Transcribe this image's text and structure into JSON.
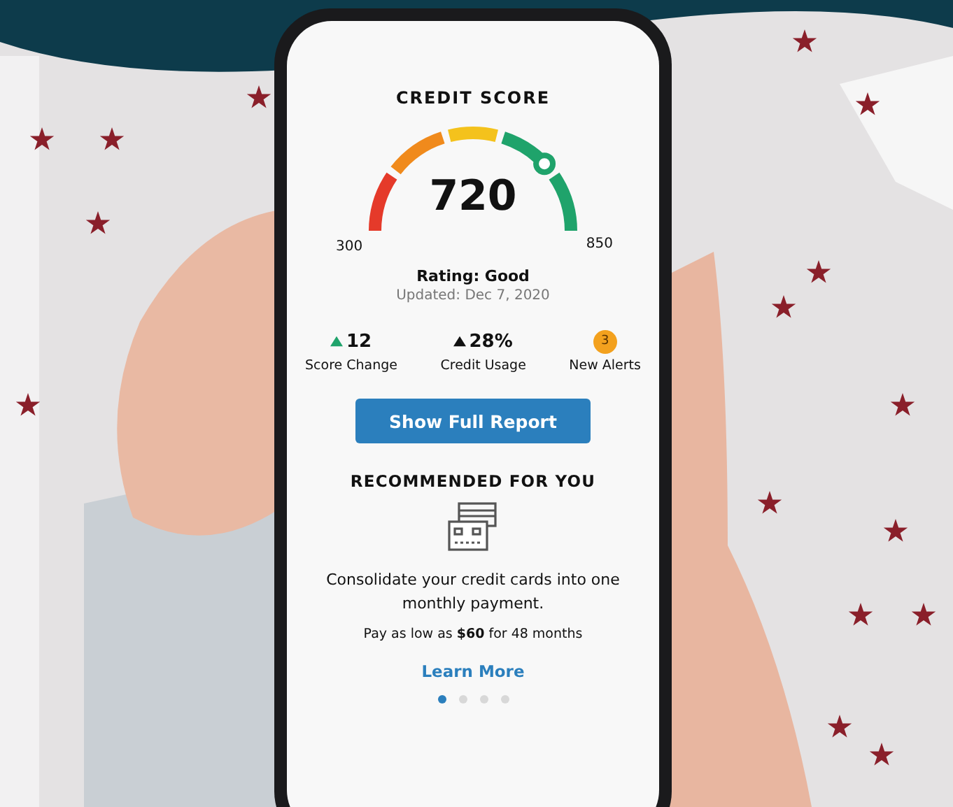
{
  "score_card": {
    "title": "CREDIT SCORE",
    "score": "720",
    "level": 0.76,
    "min_label": "300",
    "max_label": "850",
    "rating": "Rating: Good",
    "updated": "Updated: Dec 7, 2020"
  },
  "stats": [
    {
      "kind": "trend",
      "value": "12",
      "label": "Score Change",
      "color": "#1fa36b"
    },
    {
      "kind": "trend",
      "value": "28%",
      "label": "Credit Usage",
      "color": "#111111"
    },
    {
      "kind": "badge",
      "value": "3",
      "label": "New Alerts"
    }
  ],
  "report_button": "Show Full Report",
  "recommendation": {
    "title": "RECOMMENDED FOR YOU",
    "text": "Consolidate your credit cards into one monthly payment.",
    "offer": "Pay as low as **$60** for 48 months",
    "link": "Learn More"
  },
  "pages": [
    {
      "selected": true
    },
    {
      "selected": false
    },
    {
      "selected": false
    },
    {
      "selected": false
    }
  ]
}
